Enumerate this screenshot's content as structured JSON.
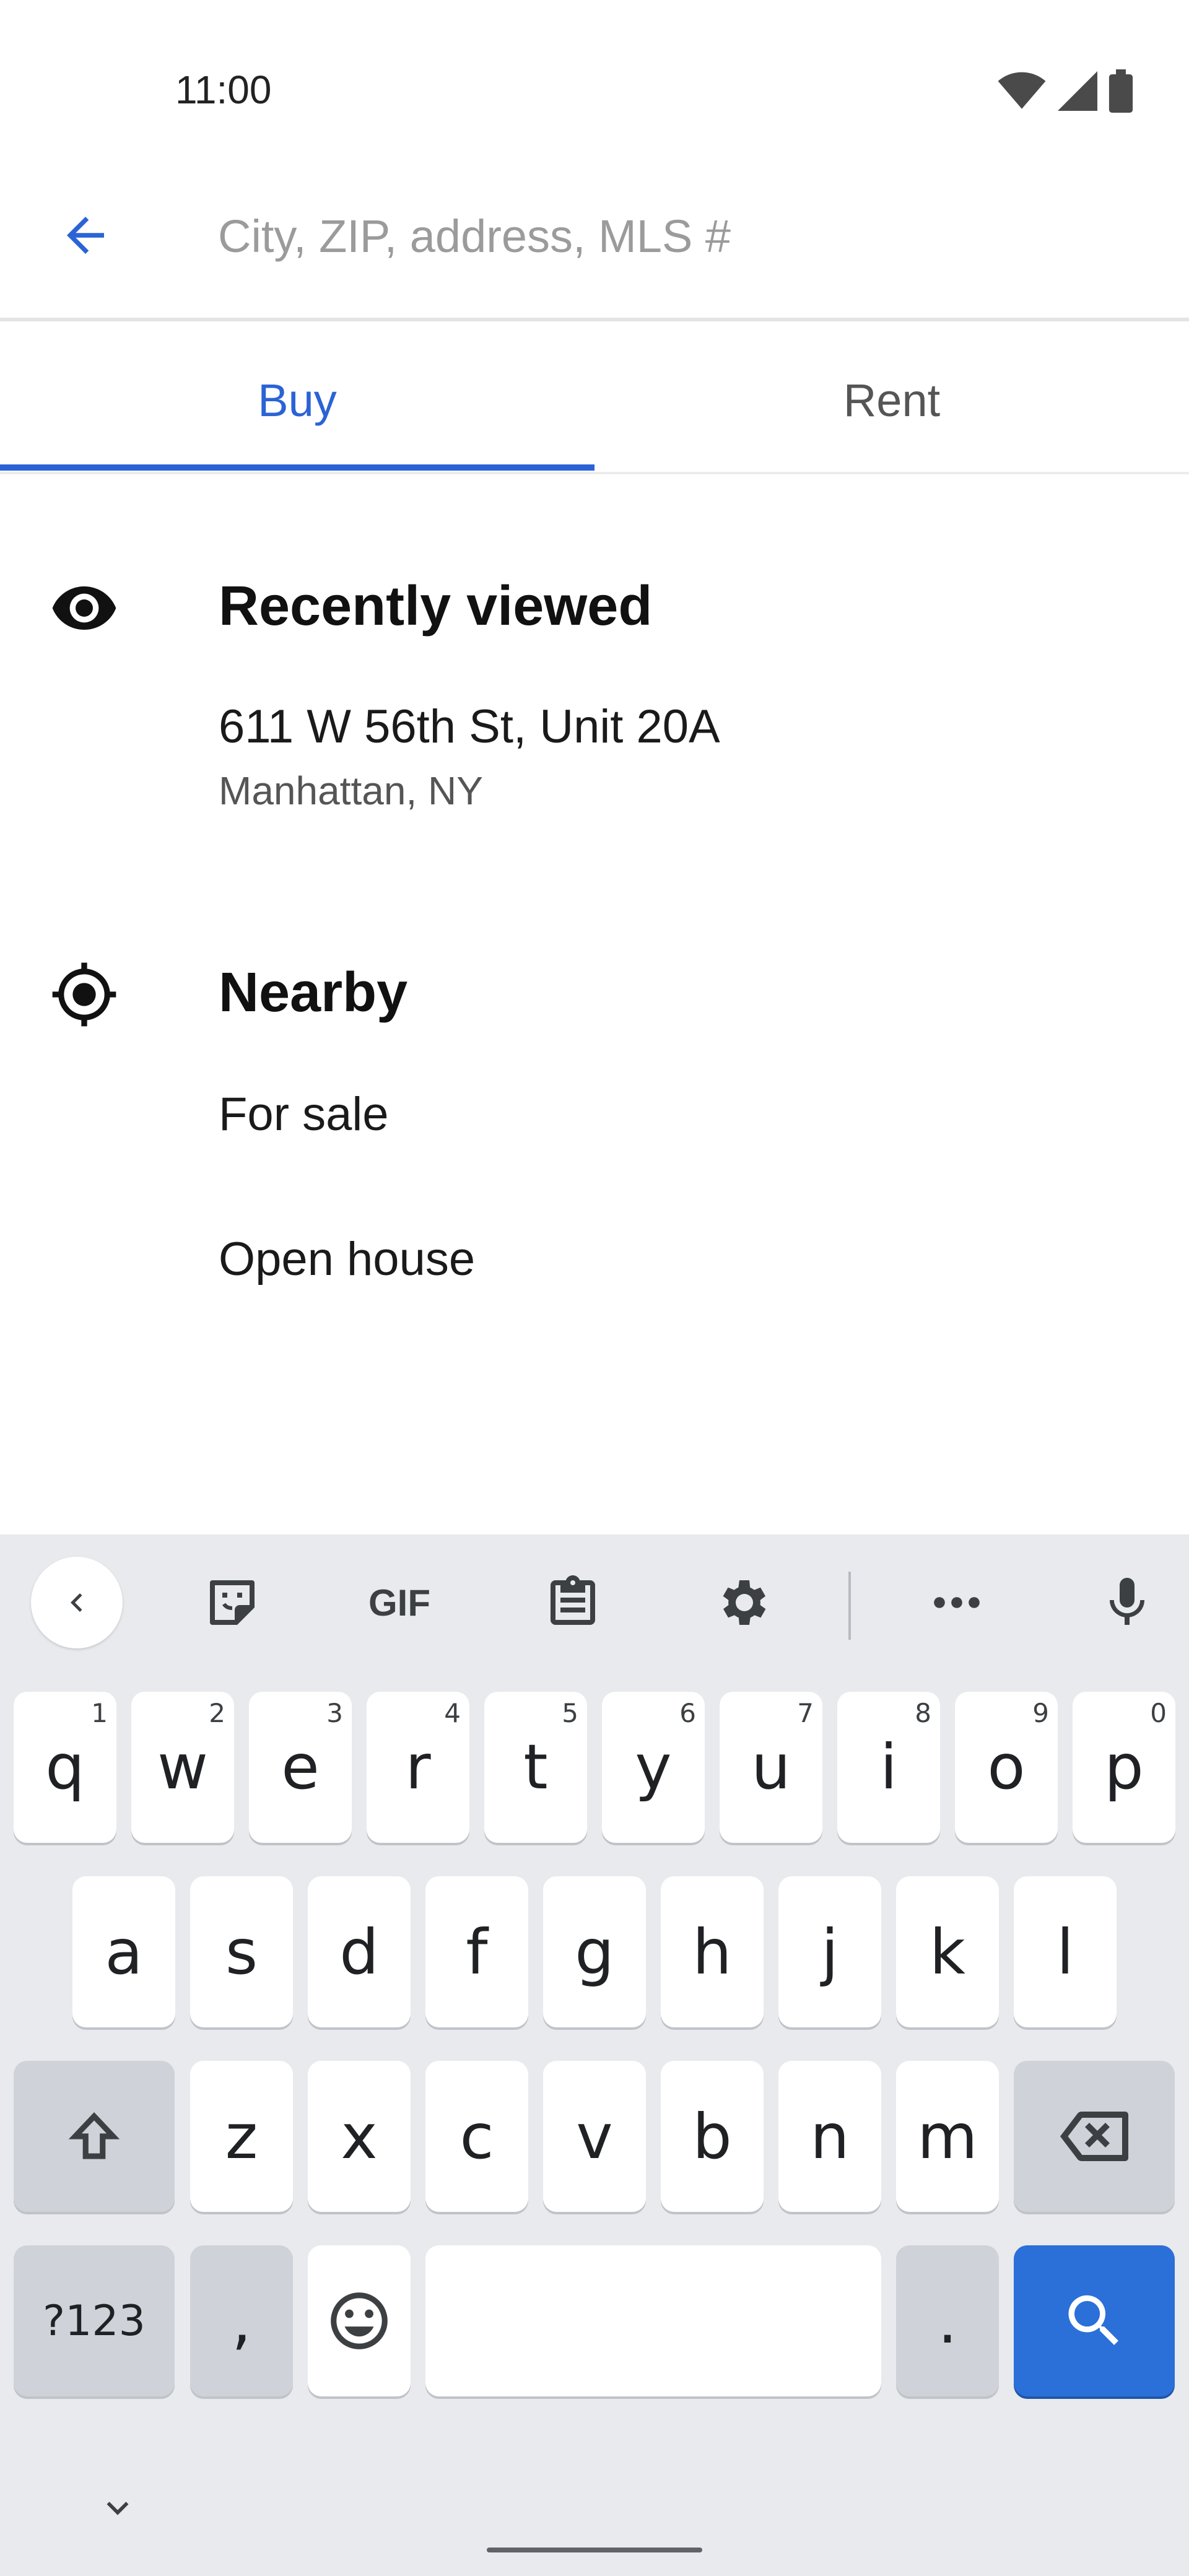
{
  "status_bar": {
    "time": "11:00"
  },
  "search": {
    "placeholder": "City, ZIP, address, MLS #"
  },
  "tabs": [
    {
      "label": "Buy",
      "active": true
    },
    {
      "label": "Rent",
      "active": false
    }
  ],
  "recently_viewed": {
    "title": "Recently viewed",
    "items": [
      {
        "address": "611 W 56th St, Unit 20A",
        "location": "Manhattan, NY"
      }
    ]
  },
  "nearby": {
    "title": "Nearby",
    "items": [
      {
        "label": "For sale"
      },
      {
        "label": "Open house"
      }
    ]
  },
  "keyboard": {
    "toolbar": {
      "gif_label": "GIF"
    },
    "row1": [
      {
        "key": "q",
        "hint": "1"
      },
      {
        "key": "w",
        "hint": "2"
      },
      {
        "key": "e",
        "hint": "3"
      },
      {
        "key": "r",
        "hint": "4"
      },
      {
        "key": "t",
        "hint": "5"
      },
      {
        "key": "y",
        "hint": "6"
      },
      {
        "key": "u",
        "hint": "7"
      },
      {
        "key": "i",
        "hint": "8"
      },
      {
        "key": "o",
        "hint": "9"
      },
      {
        "key": "p",
        "hint": "0"
      }
    ],
    "row2": [
      "a",
      "s",
      "d",
      "f",
      "g",
      "h",
      "j",
      "k",
      "l"
    ],
    "row3": [
      "z",
      "x",
      "c",
      "v",
      "b",
      "n",
      "m"
    ],
    "symbols_label": "?123",
    "comma": ",",
    "period": "."
  },
  "colors": {
    "accent": "#2b63d6",
    "keyboard_bg": "#e8eaed",
    "search_key": "#2b6fd9"
  }
}
